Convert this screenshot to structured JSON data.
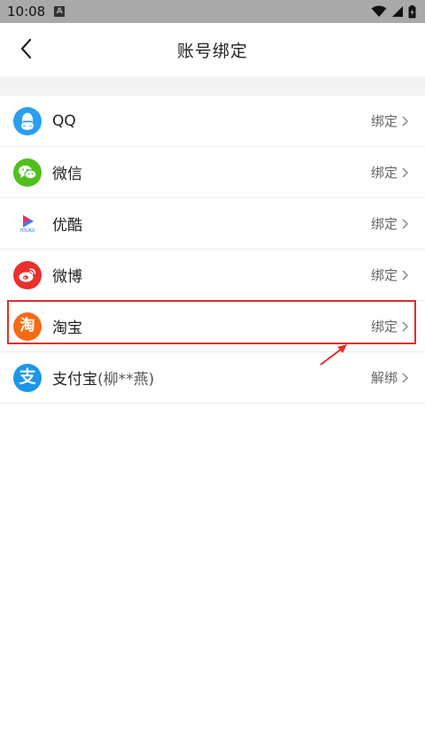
{
  "status_bar": {
    "time": "10:08",
    "notification_glyph": "A",
    "icons": [
      "wifi-icon",
      "signal-icon",
      "battery-icon"
    ]
  },
  "header": {
    "title": "账号绑定",
    "back_icon": "chevron-left-icon"
  },
  "accounts": [
    {
      "name": "QQ",
      "sub": "",
      "action": "绑定",
      "icon": "qq-icon",
      "color": "#2b9ef3"
    },
    {
      "name": "微信",
      "sub": "",
      "action": "绑定",
      "icon": "wechat-icon",
      "color": "#50c01e"
    },
    {
      "name": "优酷",
      "sub": "",
      "action": "绑定",
      "icon": "youku-icon",
      "color": "#ffffff",
      "icon_text": "YOUKU"
    },
    {
      "name": "微博",
      "sub": "",
      "action": "绑定",
      "icon": "weibo-icon",
      "color": "#e8302c"
    },
    {
      "name": "淘宝",
      "sub": "",
      "action": "绑定",
      "icon": "taobao-icon",
      "color": "#f56a14",
      "icon_text": "淘"
    },
    {
      "name": "支付宝",
      "sub": "(柳**燕)",
      "action": "解绑",
      "icon": "alipay-icon",
      "color": "#1c96e6",
      "icon_text": "支"
    }
  ],
  "annotation": {
    "highlight_color": "#e0302a"
  }
}
